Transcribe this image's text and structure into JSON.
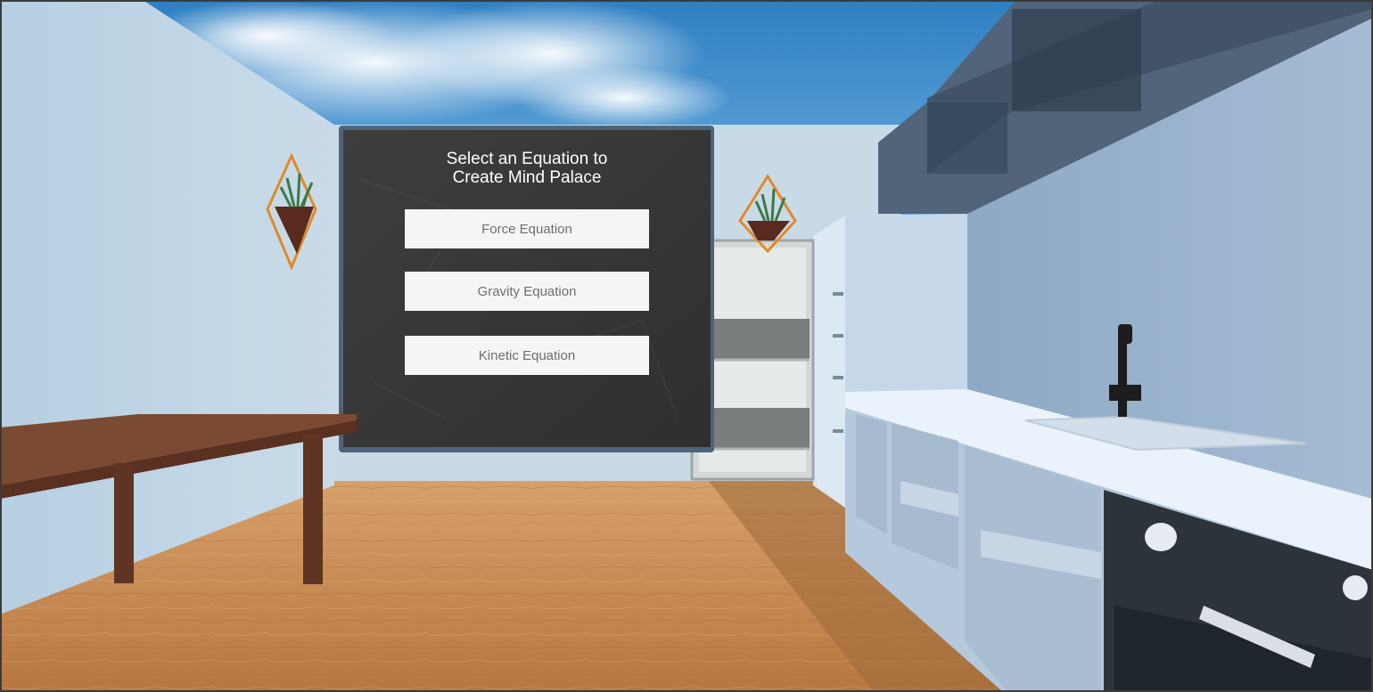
{
  "menu": {
    "title": "Select an Equation to\nCreate Mind Palace",
    "buttons": [
      {
        "label": "Force Equation"
      },
      {
        "label": "Gravity Equation"
      },
      {
        "label": "Kinetic Equation"
      }
    ]
  },
  "colors": {
    "sky": "#3f8fd0",
    "chalkboard": "#3a3a3a",
    "board_frame": "#4e6478",
    "wall": "#b8cde0",
    "floor": "#c88a4f",
    "table": "#6e3f2a",
    "counter": "#d9e6f2",
    "planter_frame": "#e08a2a"
  },
  "icons": [
    "plant-icon",
    "faucet-icon"
  ]
}
